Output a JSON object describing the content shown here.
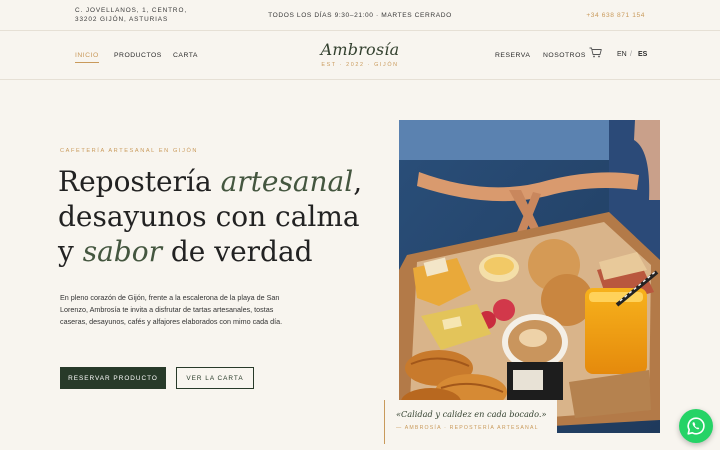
{
  "topbar": {
    "address_line1": "C. JOVELLANOS, 1, CENTRO,",
    "address_line2": "33202 GIJÓN, ASTURIAS",
    "hours": "TODOS LOS DÍAS 9:30–21:00 · MARTES CERRADO",
    "phone": "+34 638 871 154"
  },
  "nav": {
    "left": [
      "INICIO",
      "PRODUCTOS",
      "CARTA"
    ],
    "active": "INICIO",
    "right": [
      "RESERVA",
      "NOSOTROS"
    ],
    "lang_en": "EN",
    "lang_sep": "/",
    "lang_es": "ES",
    "icons": {
      "cart": "cart-icon"
    }
  },
  "brand": {
    "name": "Ambrosía",
    "tagline": "EST · 2022 · GIJÓN"
  },
  "hero": {
    "eyebrow": "CAFETERÍA ARTESANAL EN GIJÓN",
    "headline": {
      "l1a": "Repostería ",
      "l1b": "artesanal",
      "l1c": ",",
      "l2": "desayunos con calma",
      "l3a": "y ",
      "l3b": "sabor",
      "l3c": " de verdad"
    },
    "lead": "En pleno corazón de Gijón, frente a la escalerona de la playa de San Lorenzo, Ambrosía te invita a disfrutar de tartas artesanales, tostas caseras, desayunos, cafés y alfajores elaborados con mimo cada día.",
    "primary_cta": "RESERVAR PRODUCTO",
    "secondary_cta": "VER LA CARTA"
  },
  "quote": {
    "text": "«Calidad y calidez en cada bocado.»",
    "signature": "— AMBROSÍA · REPOSTERÍA ARTESANAL"
  },
  "colors": {
    "background": "#f8f5ef",
    "accent_gold": "#c99a5b",
    "brand_green": "#283a29",
    "headline_accent": "#44563f",
    "whatsapp": "#25d366"
  },
  "whatsapp": {
    "icon": "whatsapp-icon"
  }
}
